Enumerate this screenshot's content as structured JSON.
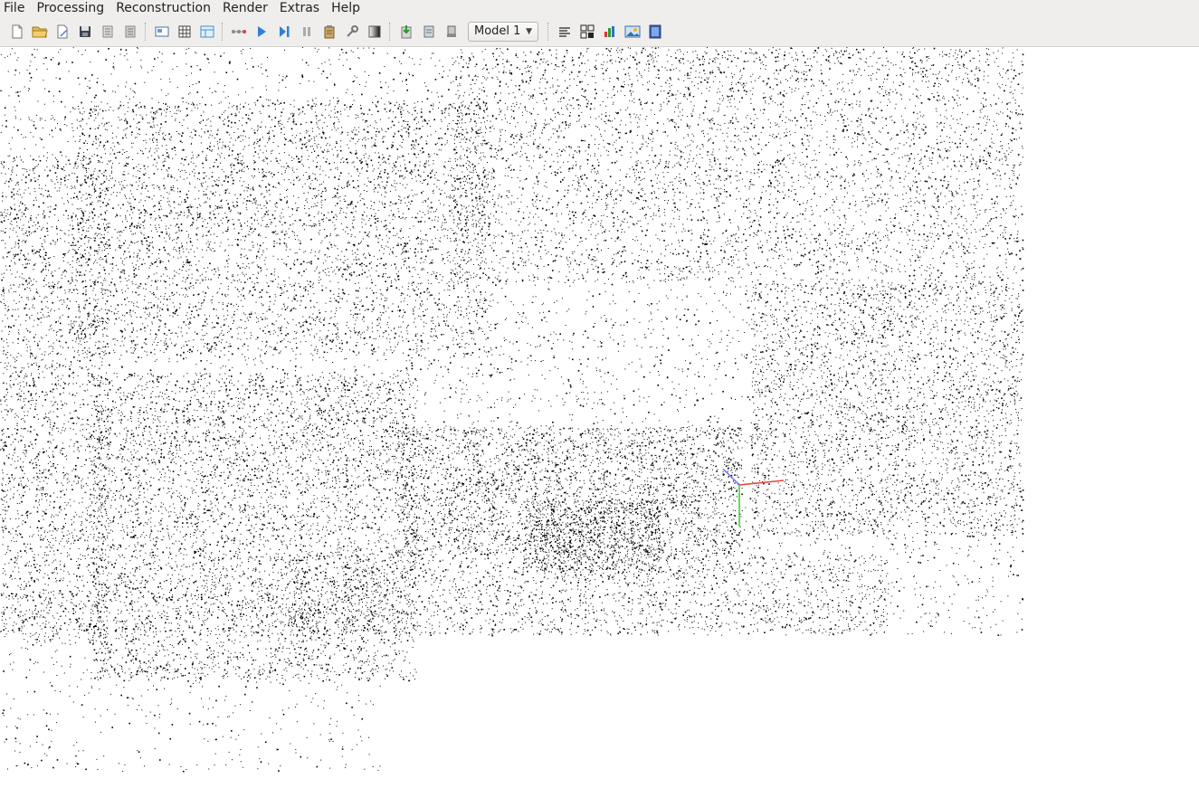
{
  "menu": [
    "File",
    "Processing",
    "Reconstruction",
    "Render",
    "Extras",
    "Help"
  ],
  "toolbar": {
    "groups": [
      [
        "new-project-icon",
        "open-project-icon",
        "edit-project-icon",
        "save-project-icon",
        "import-model-icon",
        "export-model-icon"
      ],
      [
        "feature-extraction-icon",
        "feature-matching-icon",
        "database-management-icon"
      ],
      [
        "automatic-reconstruction-icon",
        "start-reconstruction-icon",
        "step-reconstruction-icon",
        "pause-reconstruction-icon",
        "reconstruction-options-icon",
        "bundle-adjustment-icon",
        "dense-reconstruction-icon"
      ],
      [
        "render-toggle-icon",
        "render-options-icon",
        "reset-view-icon"
      ]
    ],
    "model_select": "Model 1",
    "after_select": [
      "reconstruction-stats-icon",
      "match-matrix-icon",
      "log-icon",
      "grab-image-icon",
      "grab-movie-icon"
    ]
  },
  "colors": {
    "chrome": "#efeeed",
    "points": "#000000",
    "axis_x": "#e8413b",
    "axis_y": "#2fd42f",
    "axis_z": "#6a6af0"
  }
}
